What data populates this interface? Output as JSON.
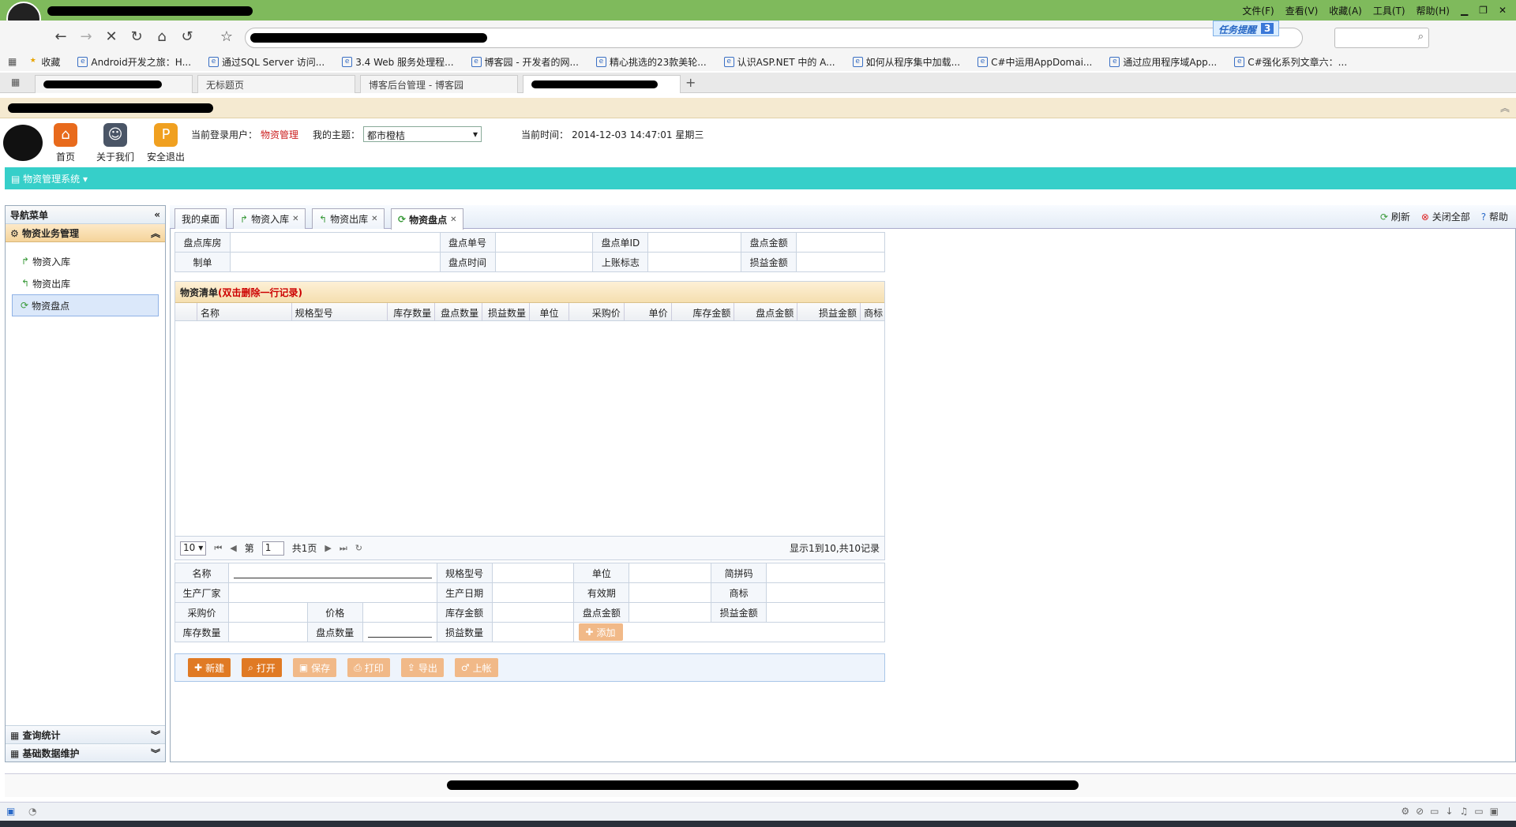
{
  "browser": {
    "menu": [
      "文件(F)",
      "查看(V)",
      "收藏(A)",
      "工具(T)",
      "帮助(H)"
    ],
    "task_badge": "任务提醒",
    "task_count": "3",
    "bookmarks": [
      {
        "label": "收藏"
      },
      {
        "label": "Android开发之旅：H..."
      },
      {
        "label": "通过SQL Server 访问..."
      },
      {
        "label": "3.4 Web 服务处理程..."
      },
      {
        "label": "博客园 - 开发者的网..."
      },
      {
        "label": "精心挑选的23款美轮..."
      },
      {
        "label": "认识ASP.NET 中的 A..."
      },
      {
        "label": "如何从程序集中加载..."
      },
      {
        "label": "C#中运用AppDomai..."
      },
      {
        "label": "通过应用程序域App..."
      },
      {
        "label": "C#强化系列文章六：..."
      }
    ],
    "tabs": [
      "无标题页",
      "博客后台管理 - 博客园"
    ]
  },
  "header": {
    "icons": [
      {
        "label": "首页",
        "glyph": "⌂",
        "color": "#e86a1c"
      },
      {
        "label": "关于我们",
        "glyph": "☺",
        "color": "#4a5566"
      },
      {
        "label": "安全退出",
        "glyph": "P",
        "color": "#f0a020"
      }
    ],
    "user_label": "当前登录用户：",
    "user_value": "物资管理",
    "theme_label": "我的主题：",
    "theme_value": "都市橙桔",
    "time_label": "当前时间：",
    "time_value": "2014-12-03 14:47:01 星期三"
  },
  "system_menu": "物资管理系统",
  "leftnav": {
    "title": "导航菜单",
    "section": "物资业务管理",
    "items": [
      "物资入库",
      "物资出库",
      "物资盘点"
    ],
    "collapsed": [
      "查询统计",
      "基础数据维护"
    ]
  },
  "tabs": [
    {
      "label": "我的桌面",
      "closable": false
    },
    {
      "label": "物资入库",
      "closable": true
    },
    {
      "label": "物资出库",
      "closable": true
    },
    {
      "label": "物资盘点",
      "closable": true
    }
  ],
  "tools": [
    "刷新",
    "关闭全部",
    "帮助"
  ],
  "top_form": {
    "row1": [
      "盘点库房",
      "盘点单号",
      "盘点单ID",
      "盘点金额"
    ],
    "row2": [
      "制单",
      "盘点时间",
      "上账标志",
      "损益金额"
    ]
  },
  "list": {
    "title": "物资清单",
    "hint": "(双击删除一行记录)",
    "columns": [
      "名称",
      "规格型号",
      "库存数量",
      "盘点数量",
      "损益数量",
      "单位",
      "采购价",
      "单价",
      "库存金额",
      "盘点金额",
      "损益金额",
      "商标"
    ],
    "pager": {
      "page_size": "10",
      "page_prefix": "第",
      "page_value": "1",
      "page_total": "共1页",
      "summary": "显示1到10,共10记录"
    }
  },
  "detail_form": {
    "row1": [
      "名称",
      "规格型号",
      "单位",
      "简拼码"
    ],
    "row2": [
      "生产厂家",
      "生产日期",
      "有效期",
      "商标"
    ],
    "row3": [
      "采购价",
      "价格",
      "库存金额",
      "盘点金额",
      "损益金额"
    ],
    "row4": [
      "库存数量",
      "盘点数量",
      "损益数量"
    ],
    "add_label": "添加"
  },
  "actions": [
    {
      "label": "新建",
      "enabled": true
    },
    {
      "label": "打开",
      "enabled": true
    },
    {
      "label": "保存",
      "enabled": false
    },
    {
      "label": "打印",
      "enabled": false
    },
    {
      "label": "导出",
      "enabled": false
    },
    {
      "label": "上帐",
      "enabled": false
    }
  ]
}
